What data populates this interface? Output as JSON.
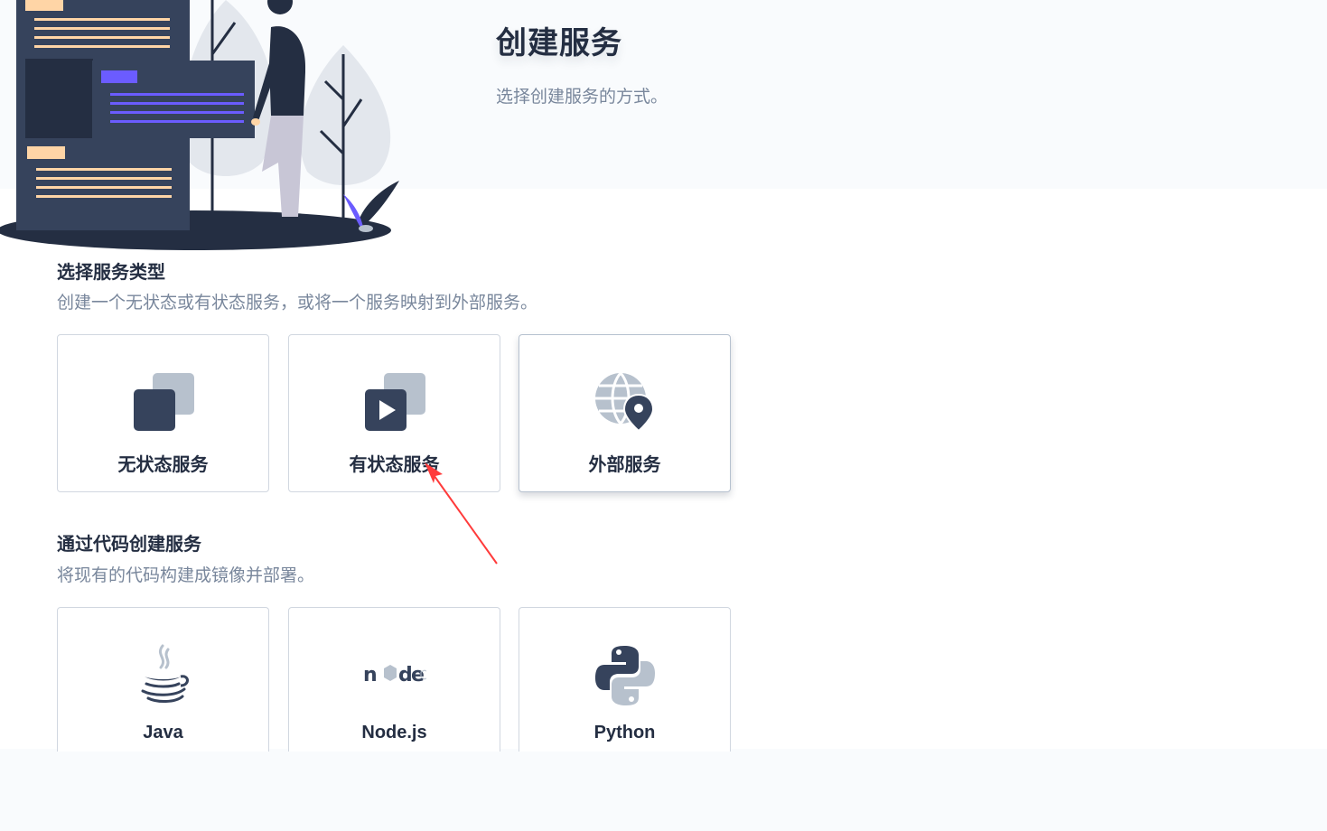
{
  "header": {
    "title": "创建服务",
    "description": "选择创建服务的方式。"
  },
  "service_type_section": {
    "title": "选择服务类型",
    "description": "创建一个无状态或有状态服务，或将一个服务映射到外部服务。",
    "cards": [
      {
        "label": "无状态服务",
        "icon": "stateless-service-icon"
      },
      {
        "label": "有状态服务",
        "icon": "stateful-service-icon"
      },
      {
        "label": "外部服务",
        "icon": "external-service-icon"
      }
    ]
  },
  "code_section": {
    "title": "通过代码创建服务",
    "description": "将现有的代码构建成镜像并部署。",
    "cards": [
      {
        "label": "Java",
        "icon": "java-icon"
      },
      {
        "label": "Node.js",
        "icon": "nodejs-icon"
      },
      {
        "label": "Python",
        "icon": "python-icon"
      }
    ]
  },
  "colors": {
    "primary_dark": "#242e42",
    "icon_dark": "#36435c",
    "icon_light": "#b7c1cd",
    "muted_text": "#79879c",
    "annotation_red": "#ff3b3b",
    "accent_purple": "#6b5cff"
  }
}
